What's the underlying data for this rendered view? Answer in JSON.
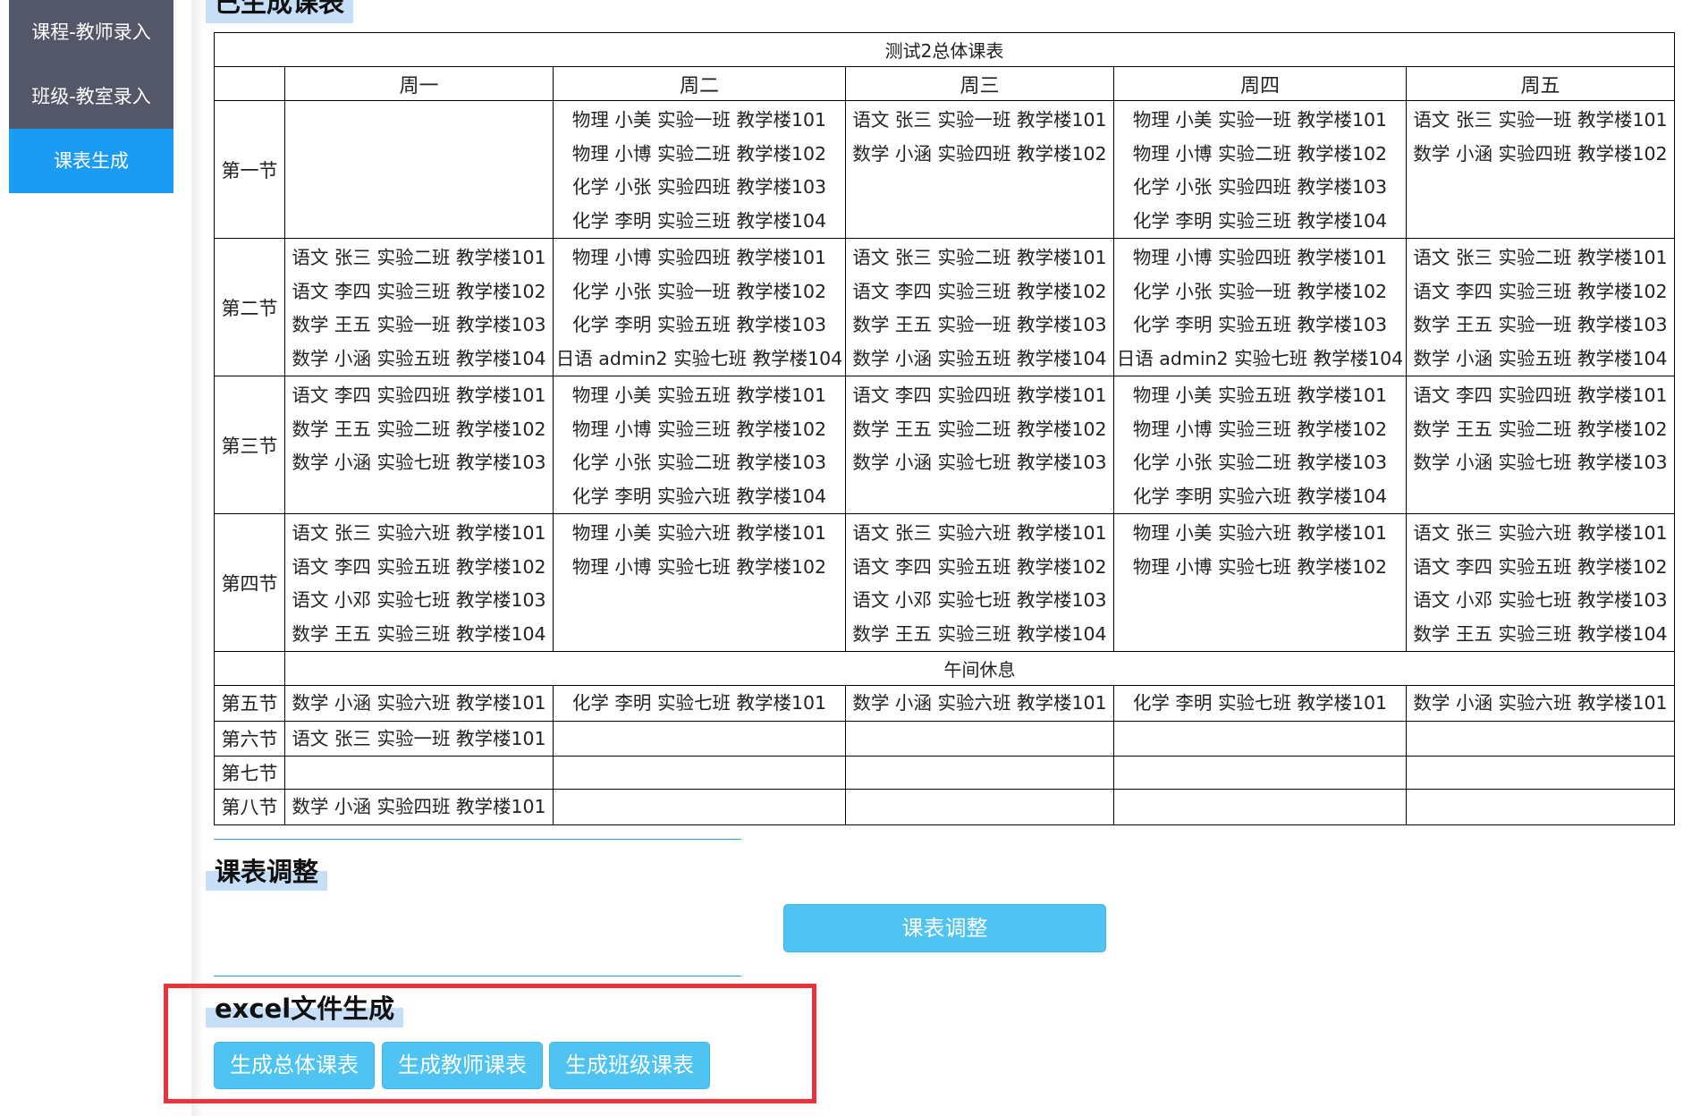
{
  "sidebar": {
    "items": [
      {
        "label": "课程-教师录入"
      },
      {
        "label": "班级-教室录入"
      },
      {
        "label": "课表生成"
      }
    ]
  },
  "sections": {
    "generated_title": "已生成课表",
    "adjust_title": "课表调整",
    "excel_title": "excel文件生成"
  },
  "timetable": {
    "caption": "测试2总体课表",
    "days": [
      "周一",
      "周二",
      "周三",
      "周四",
      "周五"
    ],
    "break_label": "午间休息",
    "periods": [
      {
        "label": "第一节",
        "cells": [
          [],
          [
            "物理 小美 实验一班 教学楼101",
            "物理 小博 实验二班 教学楼102",
            "化学 小张 实验四班 教学楼103",
            "化学 李明 实验三班 教学楼104"
          ],
          [
            "语文 张三 实验一班 教学楼101",
            "数学 小涵 实验四班 教学楼102"
          ],
          [
            "物理 小美 实验一班 教学楼101",
            "物理 小博 实验二班 教学楼102",
            "化学 小张 实验四班 教学楼103",
            "化学 李明 实验三班 教学楼104"
          ],
          [
            "语文 张三 实验一班 教学楼101",
            "数学 小涵 实验四班 教学楼102"
          ]
        ]
      },
      {
        "label": "第二节",
        "cells": [
          [
            "语文 张三 实验二班 教学楼101",
            "语文 李四 实验三班 教学楼102",
            "数学 王五 实验一班 教学楼103",
            "数学 小涵 实验五班 教学楼104"
          ],
          [
            "物理 小博 实验四班 教学楼101",
            "化学 小张 实验一班 教学楼102",
            "化学 李明 实验五班 教学楼103",
            "日语 admin2 实验七班 教学楼104"
          ],
          [
            "语文 张三 实验二班 教学楼101",
            "语文 李四 实验三班 教学楼102",
            "数学 王五 实验一班 教学楼103",
            "数学 小涵 实验五班 教学楼104"
          ],
          [
            "物理 小博 实验四班 教学楼101",
            "化学 小张 实验一班 教学楼102",
            "化学 李明 实验五班 教学楼103",
            "日语 admin2 实验七班 教学楼104"
          ],
          [
            "语文 张三 实验二班 教学楼101",
            "语文 李四 实验三班 教学楼102",
            "数学 王五 实验一班 教学楼103",
            "数学 小涵 实验五班 教学楼104"
          ]
        ]
      },
      {
        "label": "第三节",
        "cells": [
          [
            "语文 李四 实验四班 教学楼101",
            "数学 王五 实验二班 教学楼102",
            "数学 小涵 实验七班 教学楼103"
          ],
          [
            "物理 小美 实验五班 教学楼101",
            "物理 小博 实验三班 教学楼102",
            "化学 小张 实验二班 教学楼103",
            "化学 李明 实验六班 教学楼104"
          ],
          [
            "语文 李四 实验四班 教学楼101",
            "数学 王五 实验二班 教学楼102",
            "数学 小涵 实验七班 教学楼103"
          ],
          [
            "物理 小美 实验五班 教学楼101",
            "物理 小博 实验三班 教学楼102",
            "化学 小张 实验二班 教学楼103",
            "化学 李明 实验六班 教学楼104"
          ],
          [
            "语文 李四 实验四班 教学楼101",
            "数学 王五 实验二班 教学楼102",
            "数学 小涵 实验七班 教学楼103"
          ]
        ]
      },
      {
        "label": "第四节",
        "cells": [
          [
            "语文 张三 实验六班 教学楼101",
            "语文 李四 实验五班 教学楼102",
            "语文 小邓 实验七班 教学楼103",
            "数学 王五 实验三班 教学楼104"
          ],
          [
            "物理 小美 实验六班 教学楼101",
            "物理 小博 实验七班 教学楼102"
          ],
          [
            "语文 张三 实验六班 教学楼101",
            "语文 李四 实验五班 教学楼102",
            "语文 小邓 实验七班 教学楼103",
            "数学 王五 实验三班 教学楼104"
          ],
          [
            "物理 小美 实验六班 教学楼101",
            "物理 小博 实验七班 教学楼102"
          ],
          [
            "语文 张三 实验六班 教学楼101",
            "语文 李四 实验五班 教学楼102",
            "语文 小邓 实验七班 教学楼103",
            "数学 王五 实验三班 教学楼104"
          ]
        ]
      },
      {
        "label": "第五节",
        "cells": [
          [
            "数学 小涵 实验六班 教学楼101"
          ],
          [
            "化学 李明 实验七班 教学楼101"
          ],
          [
            "数学 小涵 实验六班 教学楼101"
          ],
          [
            "化学 李明 实验七班 教学楼101"
          ],
          [
            "数学 小涵 实验六班 教学楼101"
          ]
        ]
      },
      {
        "label": "第六节",
        "cells": [
          [
            "语文 张三 实验一班 教学楼101"
          ],
          [],
          [],
          [],
          []
        ]
      },
      {
        "label": "第七节",
        "cells": [
          [],
          [],
          [],
          [],
          []
        ]
      },
      {
        "label": "第八节",
        "cells": [
          [
            "数学 小涵 实验四班 教学楼101"
          ],
          [],
          [],
          [],
          []
        ]
      }
    ]
  },
  "buttons": {
    "adjust": "课表调整",
    "gen_overall": "生成总体课表",
    "gen_teacher": "生成教师课表",
    "gen_class": "生成班级课表"
  },
  "colors": {
    "sidebar_bg": "#545767",
    "sidebar_active": "#1a9cf5",
    "button": "#4fc3f2",
    "title_highlight": "#c6dff7",
    "annotation_box": "#e8343d"
  }
}
